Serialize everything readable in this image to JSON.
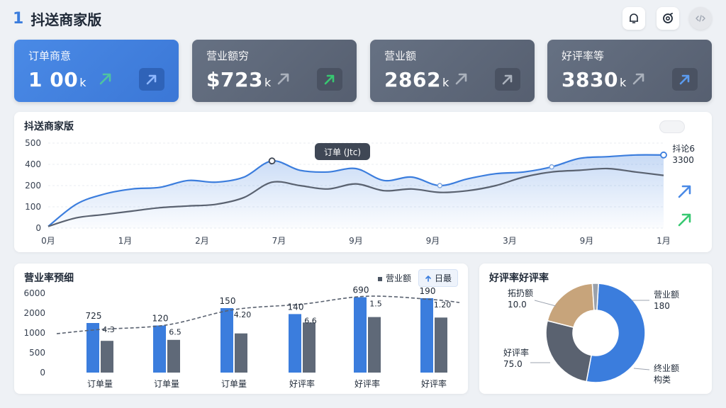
{
  "header": {
    "number": "1",
    "title": "抖送商家版"
  },
  "colors": {
    "accent": "#3b7ddd",
    "card_dark": "#5d6778",
    "series_dark": "#5a6270",
    "green": "#37c871"
  },
  "cards": [
    {
      "label": "订单商意",
      "value": "1 00",
      "unit": "k",
      "style": "blue"
    },
    {
      "label": "营业额穷",
      "value": "$723",
      "unit": "k",
      "style": "dark"
    },
    {
      "label": "营业额",
      "value": "2862",
      "unit": "k",
      "style": "dark"
    },
    {
      "label": "好评率等",
      "value": "3830",
      "unit": "k",
      "style": "dark"
    }
  ],
  "line_panel": {
    "title": "抖送商家版",
    "tooltip": "订单 (Jtc)",
    "legend_label": "抖论6",
    "legend_value": "3300"
  },
  "bar_panel": {
    "title": "营业率预细",
    "legend_series": "营业额",
    "legend_button": "日最"
  },
  "pie_panel": {
    "title": "好评率好评率"
  },
  "chart_data": [
    {
      "type": "line",
      "title": "抖送商家版",
      "categories": [
        "0月",
        "1月",
        "2月",
        "7月",
        "9月",
        "9月",
        "3月",
        "9月",
        "1月"
      ],
      "y_ticks": [
        "0",
        "100",
        "200",
        "400",
        "500"
      ],
      "ylim": [
        0,
        500
      ],
      "series": [
        {
          "values": [
            10,
            140,
            200,
            230,
            240,
            280,
            270,
            300,
            395,
            340,
            330,
            350,
            280,
            300,
            250,
            290,
            320,
            330,
            360,
            410,
            420,
            430,
            430
          ]
        },
        {
          "values": [
            10,
            60,
            80,
            100,
            120,
            130,
            140,
            180,
            270,
            250,
            230,
            260,
            220,
            230,
            210,
            220,
            250,
            300,
            330,
            340,
            350,
            330,
            310
          ]
        }
      ],
      "grid": true
    },
    {
      "type": "bar",
      "title": "营业率预细",
      "categories": [
        "订单量",
        "订单量",
        "订单量",
        "好评率",
        "好评率",
        "好评率"
      ],
      "y_ticks": [
        "0",
        "500",
        "1000",
        "2000",
        "6000"
      ],
      "series": [
        {
          "name": "营业额",
          "values": [
            1000,
            950,
            1300,
            1180,
            1520,
            1500
          ]
        },
        {
          "values": [
            640,
            660,
            790,
            1010,
            1120,
            1110
          ]
        }
      ],
      "bar_labels_a": [
        "725",
        "120",
        "150",
        "140",
        "690",
        "190"
      ],
      "bar_labels_b": [
        "4.3",
        "6.5",
        "4.20",
        "6.6",
        "1.5",
        "1.20"
      ],
      "trend": [
        870,
        960,
        1270,
        1380,
        1540,
        1470
      ]
    },
    {
      "type": "pie",
      "title": "好评率好评率",
      "slices": [
        {
          "label": "营业额",
          "value_text": "180",
          "value": 52,
          "color": "#3b7ddd"
        },
        {
          "label": "好评率",
          "value_text": "75.0",
          "value": 26,
          "color": "#5a6270"
        },
        {
          "label": "拓扔额",
          "value_text": "10.0",
          "value": 20,
          "color": "#c7a47b"
        },
        {
          "label": "",
          "value_text": "",
          "value": 2,
          "color": "#9aa1ab"
        }
      ],
      "extra_label": {
        "line1": "终业额",
        "line2": "构类"
      }
    }
  ]
}
